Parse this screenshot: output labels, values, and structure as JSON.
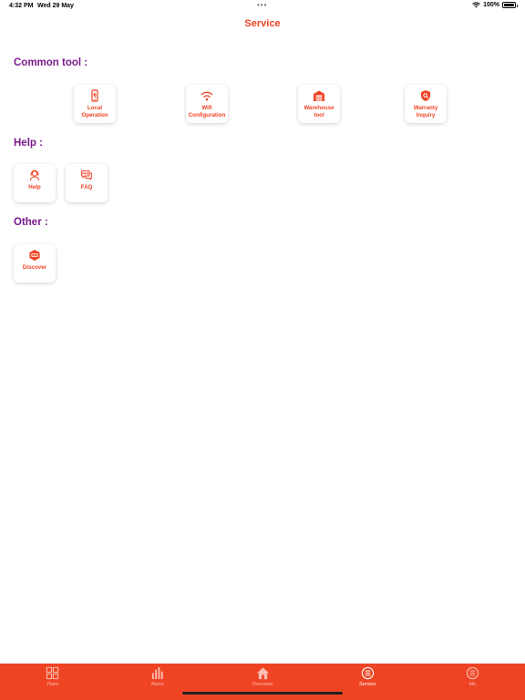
{
  "status": {
    "time": "4:32 PM",
    "date": "Wed 29 May",
    "dots": "•••",
    "battery": "100%"
  },
  "header": {
    "title": "Service"
  },
  "sections": {
    "common": {
      "title": "Common tool :",
      "items": [
        {
          "label": "Local\nOperation",
          "icon": "phone-icon"
        },
        {
          "label": "Wifi\nConfiguration",
          "icon": "wifi-icon"
        },
        {
          "label": "Warehouse\ntool",
          "icon": "warehouse-icon"
        },
        {
          "label": "Warranty\nInquiry",
          "icon": "warranty-shield-icon"
        }
      ]
    },
    "help": {
      "title": "Help :",
      "items": [
        {
          "label": "Help",
          "icon": "support-agent-icon"
        },
        {
          "label": "FAQ",
          "icon": "faq-chat-icon"
        }
      ]
    },
    "other": {
      "title": "Other :",
      "items": [
        {
          "label": "Discover",
          "icon": "discover-icon"
        }
      ]
    }
  },
  "tabbar": {
    "tabs": [
      {
        "label": "Plant",
        "icon": "grid-icon",
        "active": false
      },
      {
        "label": "Alarm",
        "icon": "bar-chart-icon",
        "active": false
      },
      {
        "label": "Overview",
        "icon": "home-icon",
        "active": false
      },
      {
        "label": "Service",
        "icon": "service-list-icon",
        "active": true
      },
      {
        "label": "Me",
        "icon": "me-list-icon",
        "active": false
      }
    ]
  },
  "colors": {
    "accent": "#ef4423",
    "section_title": "#7a1a8c",
    "tab_bar": "#ef4423"
  }
}
